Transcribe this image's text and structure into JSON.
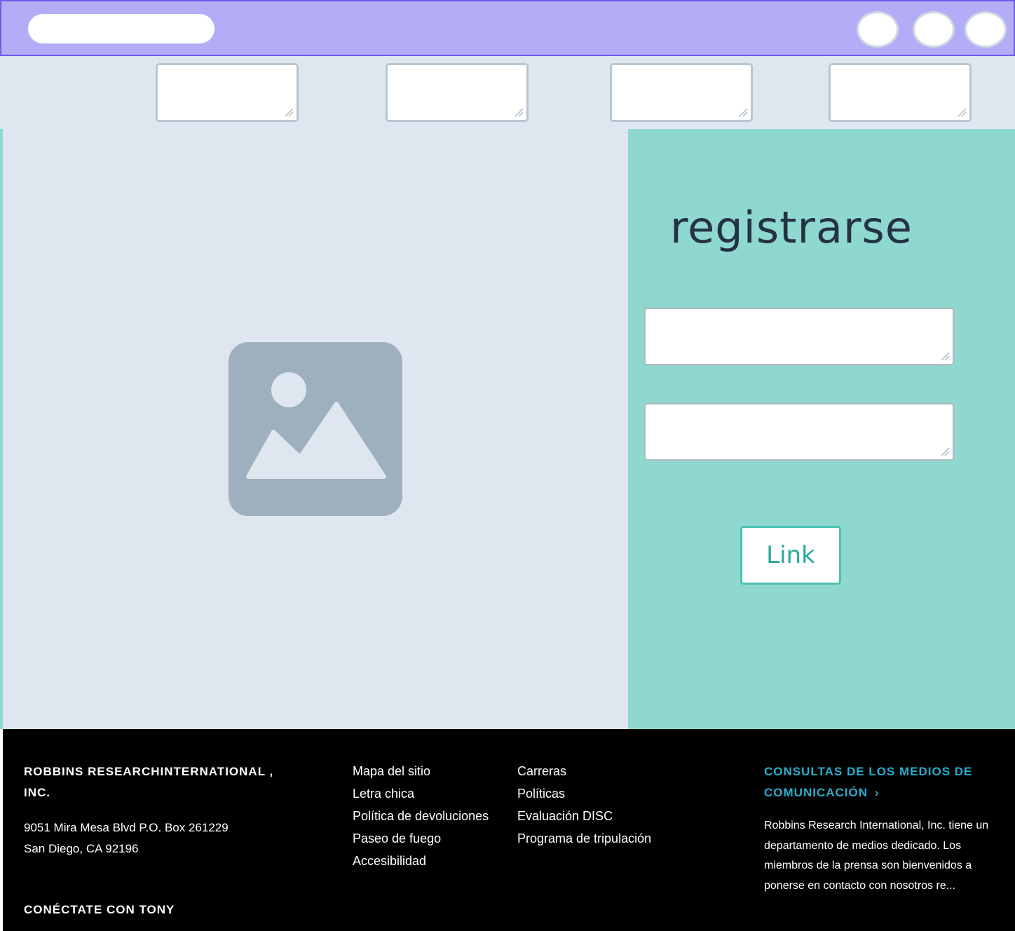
{
  "colors": {
    "topbar_bg": "#b3adf8",
    "topbar_border": "#6c5ce7",
    "nav_bg": "#dfe6ef",
    "panel_bg": "#8fd8cf",
    "title_text": "#253243",
    "link_button_text": "#28a99b",
    "footer_bg": "#000000",
    "media_link": "#29aecf"
  },
  "header": {
    "url_bar": "",
    "buttons": [
      "",
      "",
      ""
    ]
  },
  "nav": {
    "fields": [
      "",
      "",
      "",
      ""
    ]
  },
  "main": {
    "image_icon": "image-placeholder-icon"
  },
  "signup": {
    "title": "registrarse",
    "field1": "",
    "field2": "",
    "link_label": "Link"
  },
  "footer": {
    "company_name": "ROBBINS RESEARCHINTERNATIONAL , INC.",
    "address_line1": "9051 Mira Mesa Blvd P.O. Box 261229",
    "address_line2": "San Diego, CA 92196",
    "connect_title": "CONÉCTATE CON TONY",
    "links_col1": [
      "Mapa del sitio",
      "Letra chica",
      "Política de devoluciones",
      "Paseo de fuego",
      "Accesibilidad"
    ],
    "links_col2": [
      "Carreras",
      "Políticas",
      "Evaluación DISC",
      "Programa de tripulación"
    ],
    "media_title": "CONSULTAS DE LOS MEDIOS DE COMUNICACIÓN",
    "media_chevron_icon": "chevron-right-icon",
    "media_text": "Robbins Research International, Inc. tiene un departamento de medios dedicado. Los miembros de la prensa son bienvenidos a ponerse en contacto con nosotros re..."
  }
}
